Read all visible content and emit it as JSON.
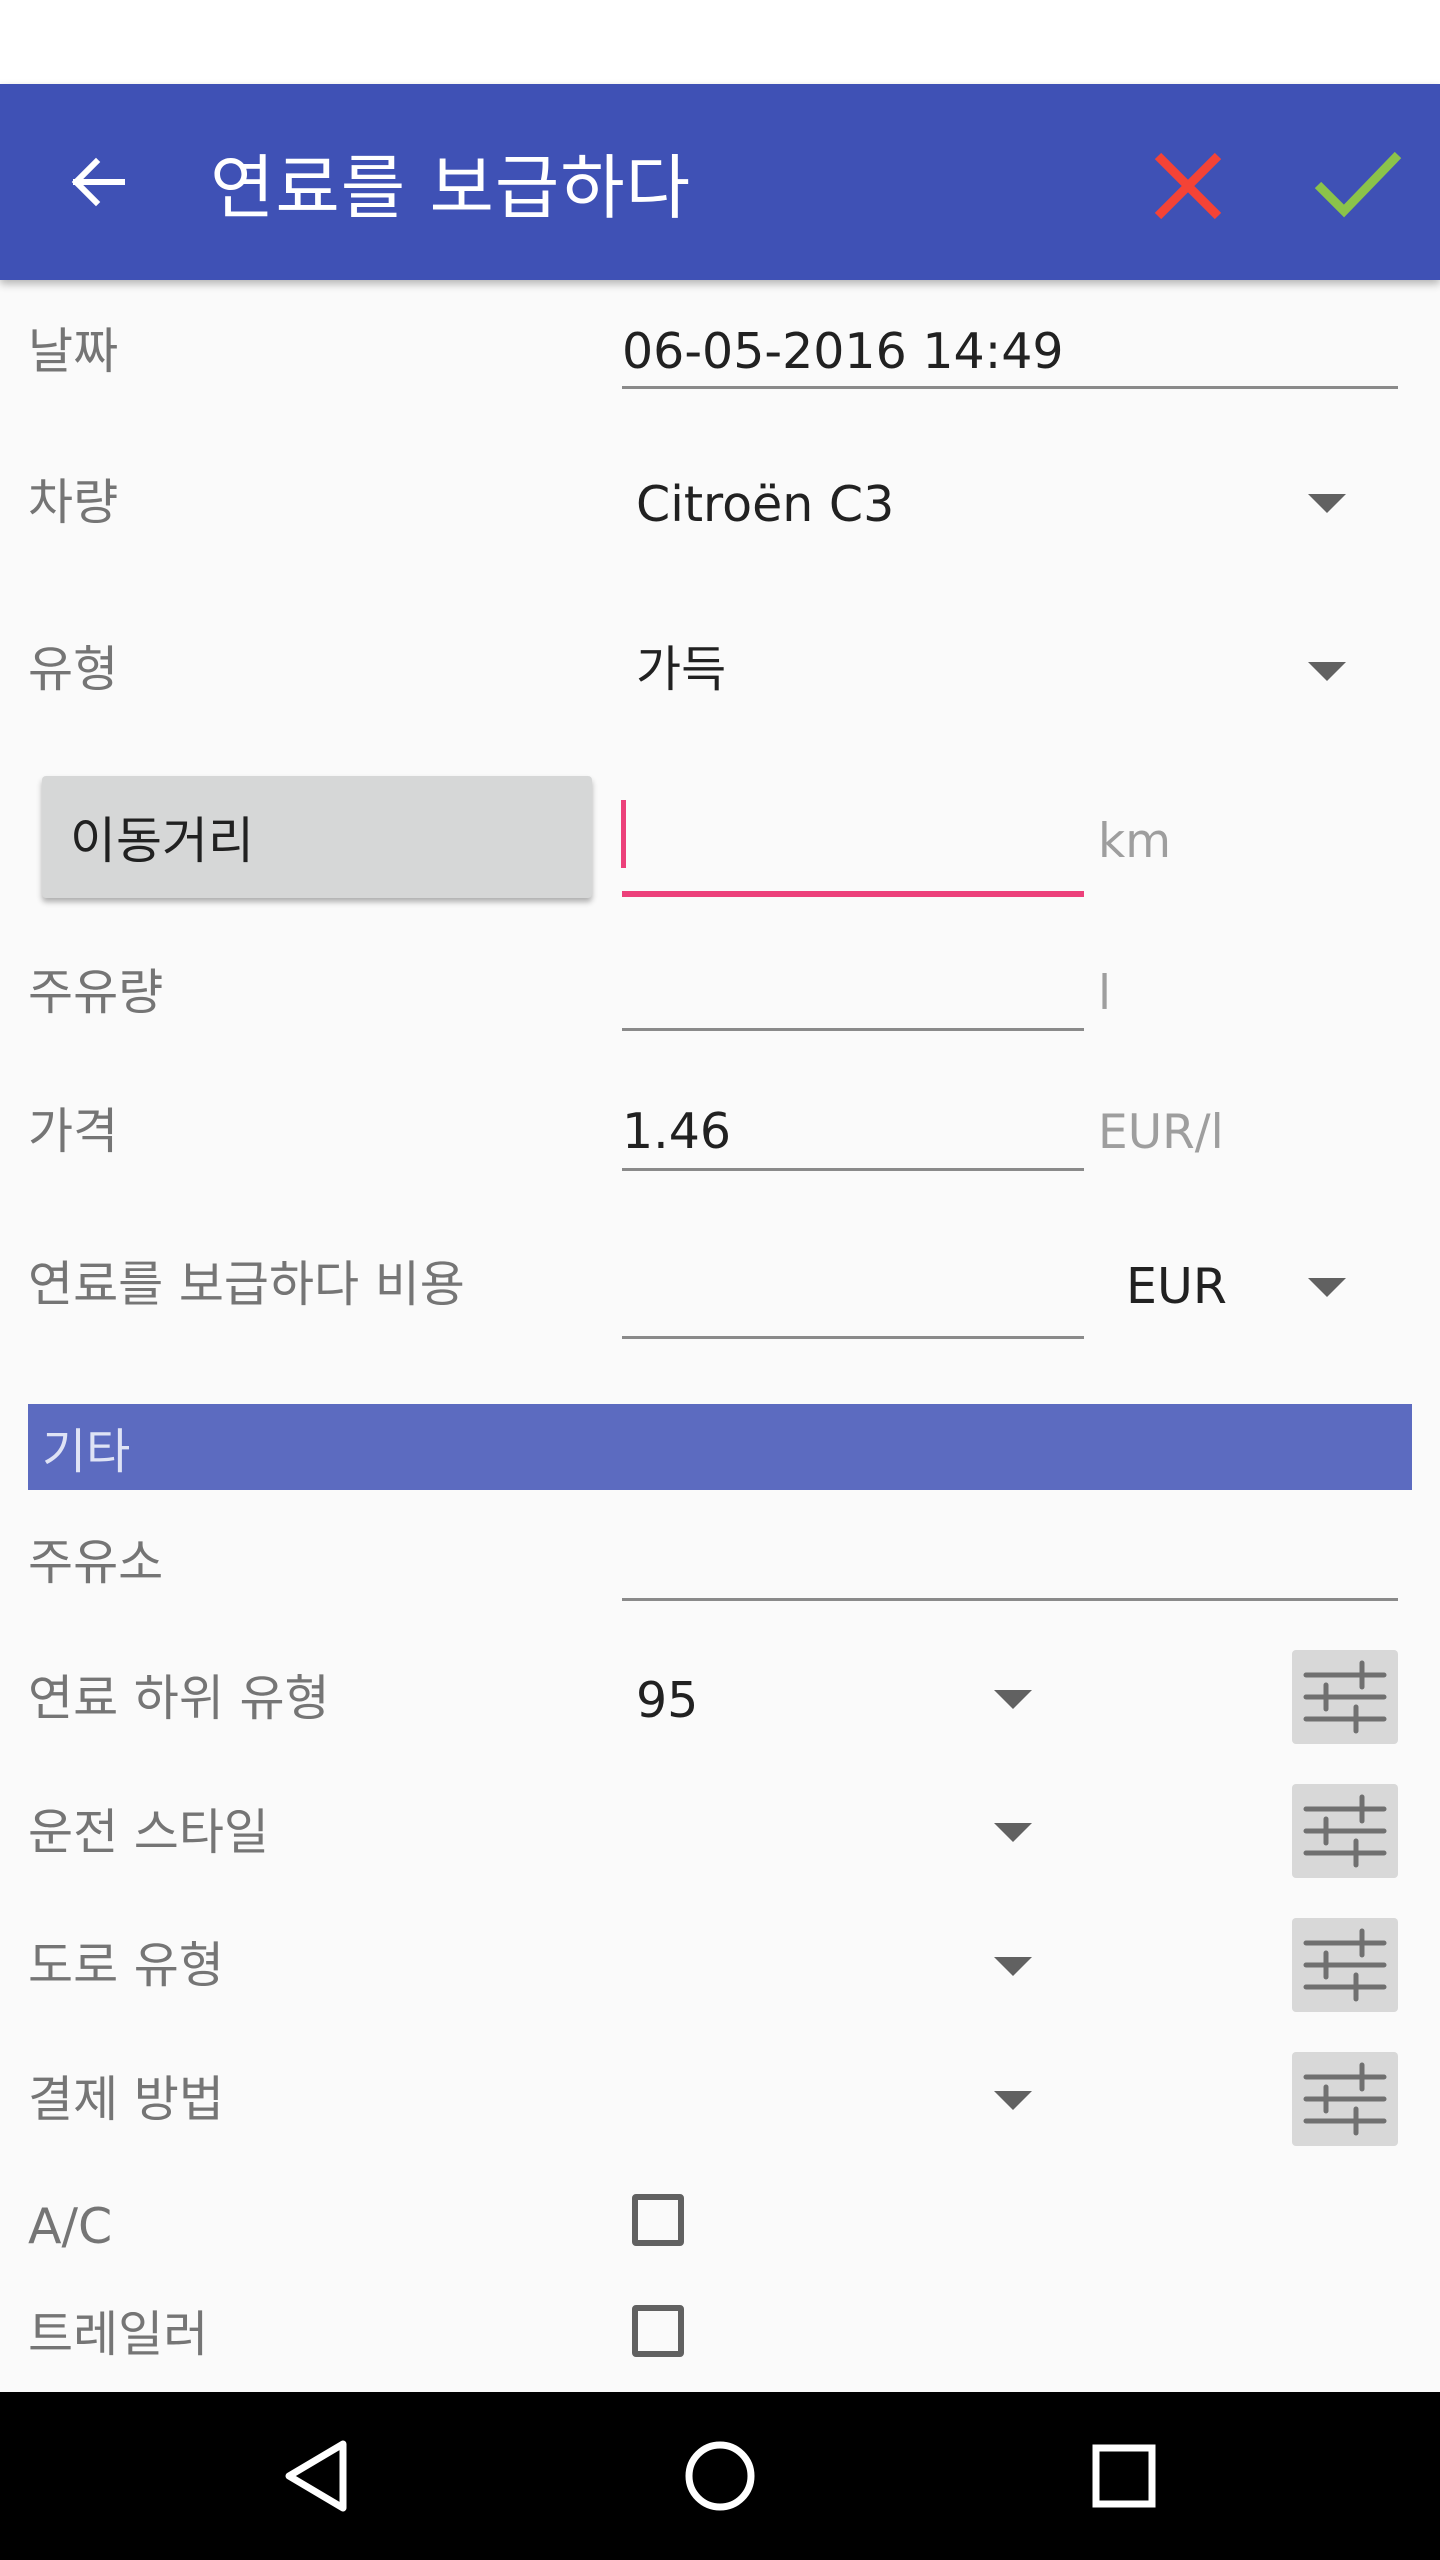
{
  "app_bar": {
    "title": "연료를 보급하다",
    "back_icon": "arrow-left-icon",
    "cancel_icon": "close-icon",
    "cancel_color": "#f44336",
    "confirm_icon": "check-icon",
    "confirm_color": "#8bc34a"
  },
  "form": {
    "date": {
      "label": "날짜",
      "value": "06-05-2016 14:49"
    },
    "vehicle": {
      "label": "차량",
      "value": "Citroën C3"
    },
    "type": {
      "label": "유형",
      "value": "가득"
    },
    "odometer": {
      "button_label": "이동거리",
      "value": "",
      "unit": "km"
    },
    "quantity": {
      "label": "주유량",
      "value": "",
      "unit": "l"
    },
    "price": {
      "label": "가격",
      "value": "1.46",
      "unit": "EUR/l"
    },
    "cost": {
      "label": "연료를 보급하다 비용",
      "value": "",
      "currency": "EUR"
    }
  },
  "other_section": {
    "header": "기타",
    "station": {
      "label": "주유소",
      "value": ""
    },
    "fuel_subtype": {
      "label": "연료 하위 유형",
      "value": "95"
    },
    "driving_style": {
      "label": "운전 스타일",
      "value": ""
    },
    "road_type": {
      "label": "도로 유형",
      "value": ""
    },
    "payment_method": {
      "label": "결제 방법",
      "value": ""
    },
    "ac": {
      "label": "A/C",
      "checked": false
    },
    "trailer": {
      "label": "트레일러",
      "checked": false
    }
  },
  "colors": {
    "primary": "#3f51b5",
    "section_header": "#5c6bc0",
    "accent": "#ec407a"
  },
  "nav": {
    "back_icon": "nav-back-triangle-icon",
    "home_icon": "nav-home-circle-icon",
    "recents_icon": "nav-recents-square-icon"
  }
}
